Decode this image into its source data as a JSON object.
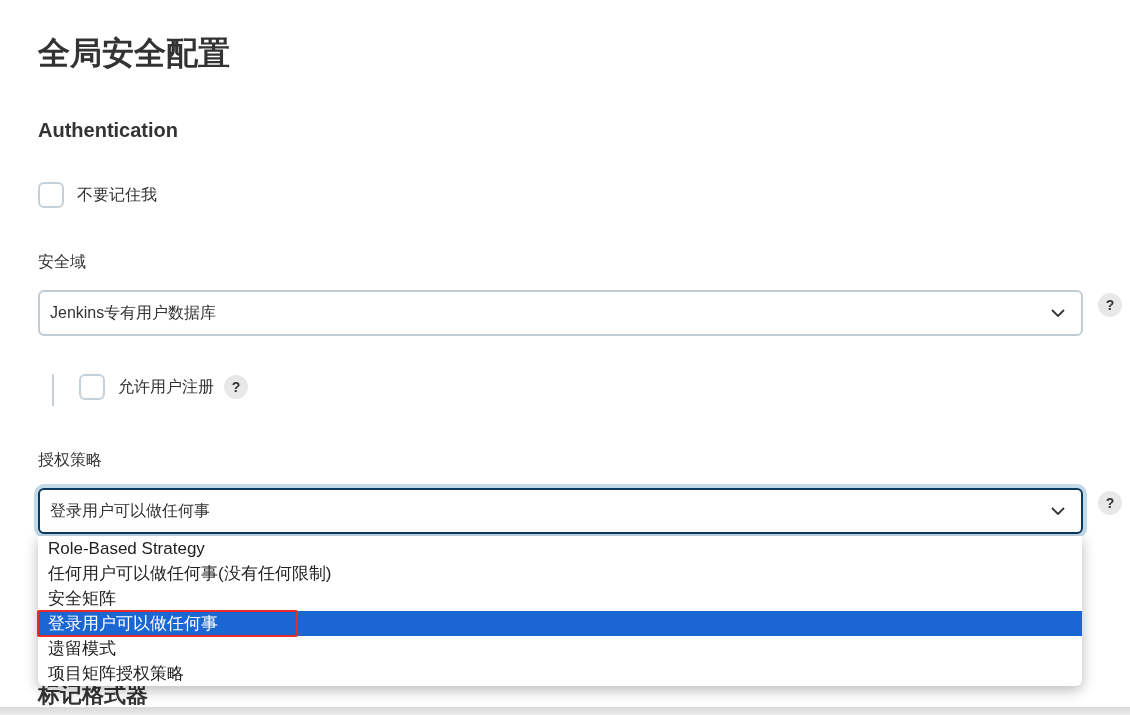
{
  "page": {
    "title": "全局安全配置"
  },
  "authentication": {
    "heading": "Authentication",
    "items": [
      {
        "kind": "checkbox",
        "label": "不要记住我",
        "checked": false
      },
      {
        "kind": "select",
        "label": "安全域",
        "value": "Jenkins专有用户数据库",
        "help": "?",
        "focused": false,
        "nested": [
          {
            "kind": "checkbox",
            "label": "允许用户注册",
            "checked": false,
            "help": "?"
          }
        ]
      },
      {
        "kind": "select",
        "label": "授权策略",
        "value": "登录用户可以做任何事",
        "help": "?",
        "focused": true,
        "expanded": true,
        "options": [
          {
            "label": "Role-Based Strategy",
            "selected": false,
            "annotated": false
          },
          {
            "label": "任何用户可以做任何事(没有任何限制)",
            "selected": false,
            "annotated": false
          },
          {
            "label": "安全矩阵",
            "selected": false,
            "annotated": false
          },
          {
            "label": "登录用户可以做任何事",
            "selected": true,
            "annotated": true
          },
          {
            "label": "遗留模式",
            "selected": false,
            "annotated": false
          },
          {
            "label": "项目矩阵授权策略",
            "selected": false,
            "annotated": false
          }
        ]
      }
    ]
  },
  "next_section": {
    "heading": "标记格式器"
  }
}
